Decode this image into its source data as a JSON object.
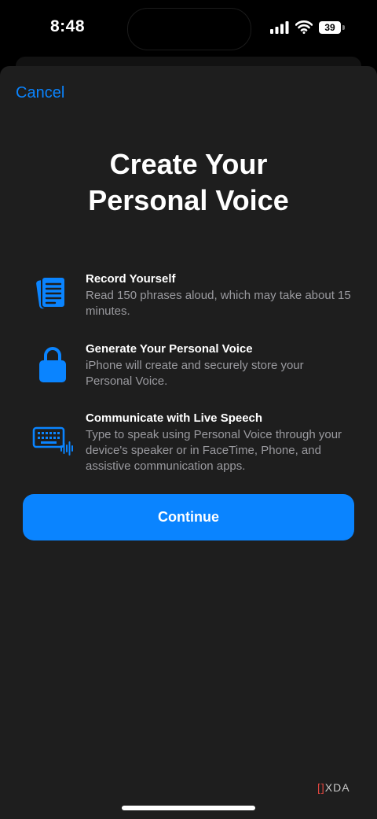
{
  "status_bar": {
    "time": "8:48",
    "battery": "39",
    "icons": [
      "cellular-signal-icon",
      "wifi-icon",
      "battery-icon"
    ]
  },
  "nav": {
    "cancel_label": "Cancel"
  },
  "title": {
    "line1": "Create Your",
    "line2": "Personal Voice"
  },
  "features": [
    {
      "icon": "document-icon",
      "title": "Record Yourself",
      "description": "Read 150 phrases aloud, which may take about 15 minutes."
    },
    {
      "icon": "lock-icon",
      "title": "Generate Your Personal Voice",
      "description": "iPhone will create and securely store your Personal Voice."
    },
    {
      "icon": "keyboard-waveform-icon",
      "title": "Communicate with Live Speech",
      "description": "Type to speak using Personal Voice through your device's speaker or in FaceTime, Phone, and assistive communication apps."
    }
  ],
  "continue_label": "Continue",
  "watermark": "XDA",
  "colors": {
    "accent": "#0a84ff",
    "sheet_background": "#1e1e1e",
    "secondary_text": "#9a9a9f"
  }
}
